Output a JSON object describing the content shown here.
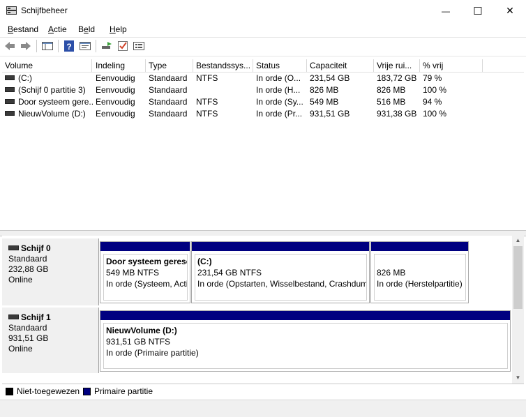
{
  "window": {
    "title": "Schijfbeheer",
    "minimize": "—",
    "maximize": "☐",
    "close": "✕"
  },
  "menu": [
    {
      "label": "Bestand",
      "key": "B",
      "rest": "estand"
    },
    {
      "label": "Actie",
      "key": "A",
      "rest": "ctie"
    },
    {
      "label": "Beeld",
      "key": "e",
      "pre": "B",
      "rest": "ld"
    },
    {
      "label": "Help",
      "key": "H",
      "rest": "elp"
    }
  ],
  "toolbar": [
    "back-icon",
    "forward-icon",
    "console-tree-icon",
    "help-icon",
    "properties-icon",
    "connect-icon",
    "check-icon",
    "settings-icon"
  ],
  "columns": [
    "Volume",
    "Indeling",
    "Type",
    "Bestandssys...",
    "Status",
    "Capaciteit",
    "Vrije rui...",
    "% vrij"
  ],
  "volumes": [
    {
      "volume": "(C:)",
      "indeling": "Eenvoudig",
      "type": "Standaard",
      "fs": "NTFS",
      "status": "In orde (O...",
      "capaciteit": "231,54 GB",
      "vrij": "183,72 GB",
      "pct": "79 %"
    },
    {
      "volume": "(Schijf 0 partitie 3)",
      "indeling": "Eenvoudig",
      "type": "Standaard",
      "fs": "",
      "status": "In orde (H...",
      "capaciteit": "826 MB",
      "vrij": "826 MB",
      "pct": "100 %"
    },
    {
      "volume": "Door systeem gere...",
      "indeling": "Eenvoudig",
      "type": "Standaard",
      "fs": "NTFS",
      "status": "In orde (Sy...",
      "capaciteit": "549 MB",
      "vrij": "516 MB",
      "pct": "94 %"
    },
    {
      "volume": "NieuwVolume (D:)",
      "indeling": "Eenvoudig",
      "type": "Standaard",
      "fs": "NTFS",
      "status": "In orde (Pr...",
      "capaciteit": "931,51 GB",
      "vrij": "931,38 GB",
      "pct": "100 %"
    }
  ],
  "disks": [
    {
      "name": "Schijf 0",
      "type": "Standaard",
      "size": "232,88 GB",
      "state": "Online",
      "partitions": [
        {
          "name": "Door systeem gereserveerd",
          "size": "549 MB NTFS",
          "status": "In orde (Systeem, Actief, Primaire partitie)"
        },
        {
          "name": "(C:)",
          "size": "231,54 GB NTFS",
          "status": "In orde (Opstarten, Wisselbestand, Crashdump, Primaire partitie)"
        },
        {
          "name": "",
          "size": "826 MB",
          "status": "In orde (Herstelpartitie)"
        }
      ]
    },
    {
      "name": "Schijf 1",
      "type": "Standaard",
      "size": "931,51 GB",
      "state": "Online",
      "partitions": [
        {
          "name": "NieuwVolume  (D:)",
          "size": "931,51 GB NTFS",
          "status": "In orde (Primaire partitie)"
        }
      ]
    }
  ],
  "legend": [
    {
      "label": "Niet-toegewezen",
      "color": "#000000"
    },
    {
      "label": "Primaire partitie",
      "color": "#000080"
    }
  ]
}
